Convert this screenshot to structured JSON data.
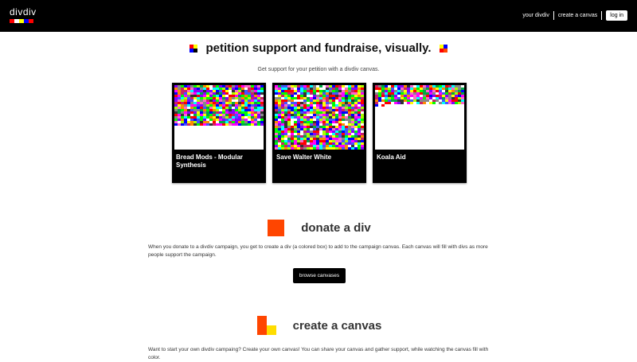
{
  "header": {
    "logo": "divdiv",
    "logo_colors": [
      "#ff0000",
      "#ffffff",
      "#ffff00",
      "#0000ff",
      "#ff0000"
    ],
    "nav": {
      "your_divdiv": "your divdiv",
      "create_canvas": "create a canvas",
      "login": "log in"
    }
  },
  "hero": {
    "title": "petition support and fundraise, visually.",
    "subtitle": "Get support for your petition with a divdiv canvas."
  },
  "cards": [
    {
      "title": "Bread Mods - Modular Synthesis",
      "fill": 0.63
    },
    {
      "title": "Save Walter White",
      "fill": 1.0
    },
    {
      "title": "Koala Aid",
      "fill": 0.3
    }
  ],
  "donate": {
    "title": "donate a div",
    "text": "When you donate to a divdiv campaign, you get to create a div (a colored box) to add to the campaign canvas. Each canvas will fill with divs as more people support the campaign.",
    "button": "browse canvases",
    "icon_color": "#ff4500"
  },
  "create": {
    "title": "create a canvas",
    "text": "Want to start your own divdiv campaing? Create your own canvas! You can share your canvas and gather support, while watching the canvas fill with color."
  }
}
